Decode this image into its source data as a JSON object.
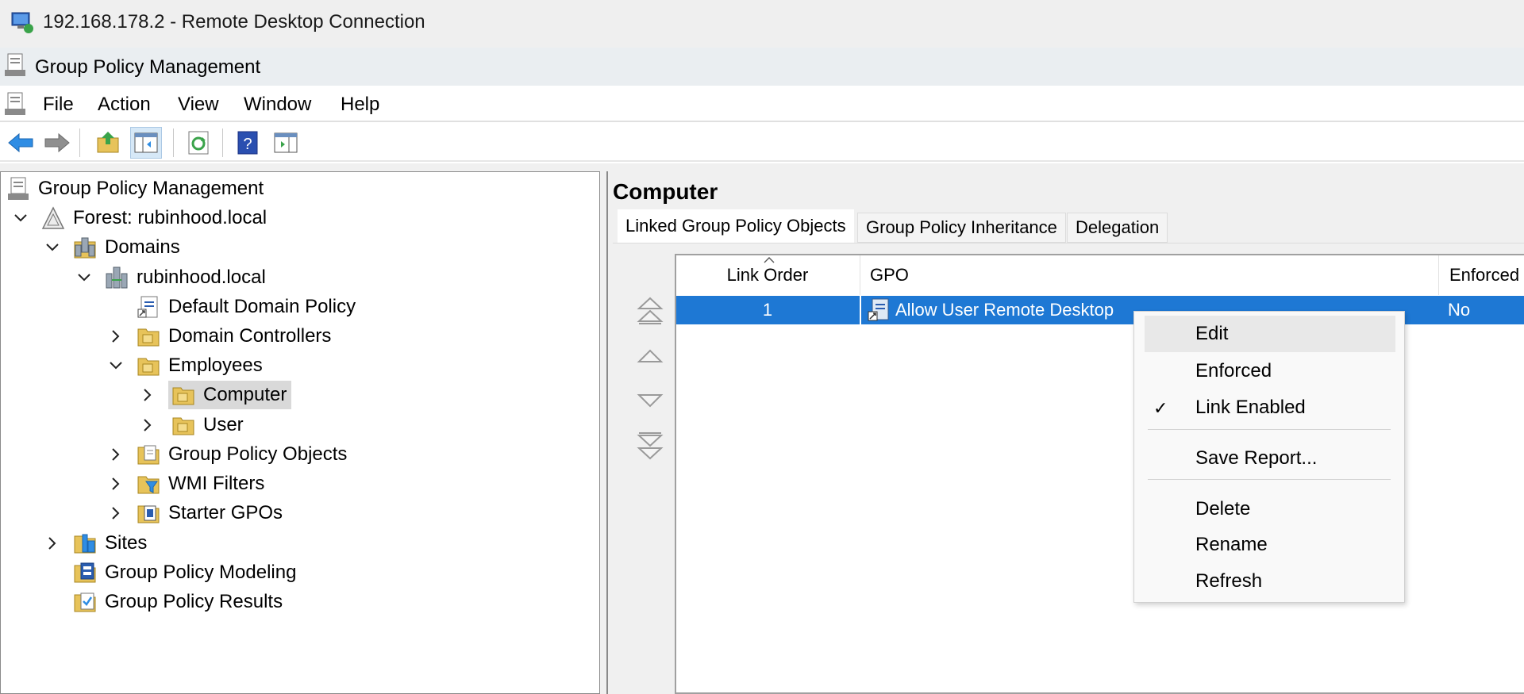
{
  "rdp_window": {
    "title": "192.168.178.2 - Remote Desktop Connection",
    "icon": "remote-desktop-icon"
  },
  "app": {
    "title": "Group Policy Management",
    "icon": "group-policy-management-icon"
  },
  "menu": {
    "file": "File",
    "action": "Action",
    "view": "View",
    "window": "Window",
    "help": "Help"
  },
  "toolbar": [
    "back-icon",
    "forward-icon",
    "up-folder-icon",
    "show-hide-console-tree-icon",
    "refresh-icon",
    "help-icon",
    "show-hide-action-pane-icon"
  ],
  "tree": {
    "root": "Group Policy Management",
    "forest": "Forest: rubinhood.local",
    "domains": "Domains",
    "domain": "rubinhood.local",
    "default_domain_policy": "Default Domain Policy",
    "domain_controllers": "Domain Controllers",
    "employees": "Employees",
    "computer": "Computer",
    "user": "User",
    "group_policy_objects": "Group Policy Objects",
    "wmi_filters": "WMI Filters",
    "starter_gpos": "Starter GPOs",
    "sites": "Sites",
    "group_policy_modeling": "Group Policy Modeling",
    "group_policy_results": "Group Policy Results"
  },
  "detail": {
    "title": "Computer",
    "tabs": {
      "linked": "Linked Group Policy Objects",
      "inheritance": "Group Policy Inheritance",
      "delegation": "Delegation"
    },
    "columns": {
      "link_order": "Link Order",
      "gpo": "GPO",
      "enforced": "Enforced"
    },
    "rows": [
      {
        "link_order": "1",
        "gpo": "Allow User Remote Desktop",
        "enforced": "No"
      }
    ]
  },
  "context_menu": {
    "edit": "Edit",
    "enforced": "Enforced",
    "link_enabled": "Link Enabled",
    "link_enabled_check": "✓",
    "save_report": "Save Report...",
    "delete": "Delete",
    "rename": "Rename",
    "refresh": "Refresh"
  },
  "colors": {
    "selection": "#1e78d4",
    "toolbar_pressed": "#d6e8f7",
    "tree_selected": "#d9d9d9"
  }
}
